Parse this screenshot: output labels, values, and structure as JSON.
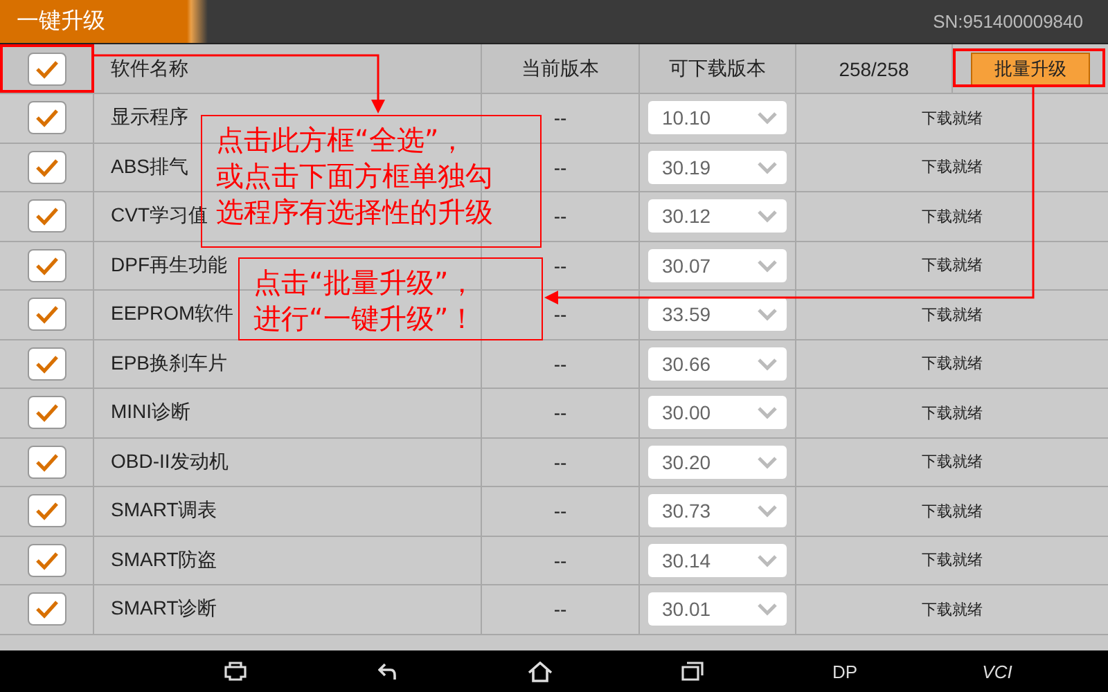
{
  "title_bar": {
    "title": "一键升级",
    "serial": "SN:951400009840"
  },
  "header": {
    "select_all": {
      "checked": true
    },
    "columns": [
      "软件名称",
      "当前版本",
      "可下载版本"
    ],
    "count": "258/258",
    "batch_button": "批量升级"
  },
  "rows": [
    {
      "checked": true,
      "name": "显示程序",
      "current": "--",
      "available": "10.10",
      "status": "下载就绪"
    },
    {
      "checked": true,
      "name": "ABS排气",
      "current": "--",
      "available": "30.19",
      "status": "下载就绪"
    },
    {
      "checked": true,
      "name": "CVT学习值",
      "current": "--",
      "available": "30.12",
      "status": "下载就绪"
    },
    {
      "checked": true,
      "name": "DPF再生功能",
      "current": "--",
      "available": "30.07",
      "status": "下载就绪"
    },
    {
      "checked": true,
      "name": "EEPROM软件",
      "current": "--",
      "available": "33.59",
      "status": "下载就绪"
    },
    {
      "checked": true,
      "name": "EPB换刹车片",
      "current": "--",
      "available": "30.66",
      "status": "下载就绪"
    },
    {
      "checked": true,
      "name": "MINI诊断",
      "current": "--",
      "available": "30.00",
      "status": "下载就绪"
    },
    {
      "checked": true,
      "name": "OBD-II发动机",
      "current": "--",
      "available": "30.20",
      "status": "下载就绪"
    },
    {
      "checked": true,
      "name": "SMART调表",
      "current": "--",
      "available": "30.73",
      "status": "下载就绪"
    },
    {
      "checked": true,
      "name": "SMART防盗",
      "current": "--",
      "available": "30.14",
      "status": "下载就绪"
    },
    {
      "checked": true,
      "name": "SMART诊断",
      "current": "--",
      "available": "30.01",
      "status": "下载就绪"
    }
  ],
  "annotations": [
    "点击此方框“全选”，或点击下面方框单独勾选程序有选择性的升级",
    "点击“批量升级”，进行“一键升级”！"
  ],
  "nav_bar": {
    "dp_label": "DP",
    "vci_label": "VCI"
  }
}
